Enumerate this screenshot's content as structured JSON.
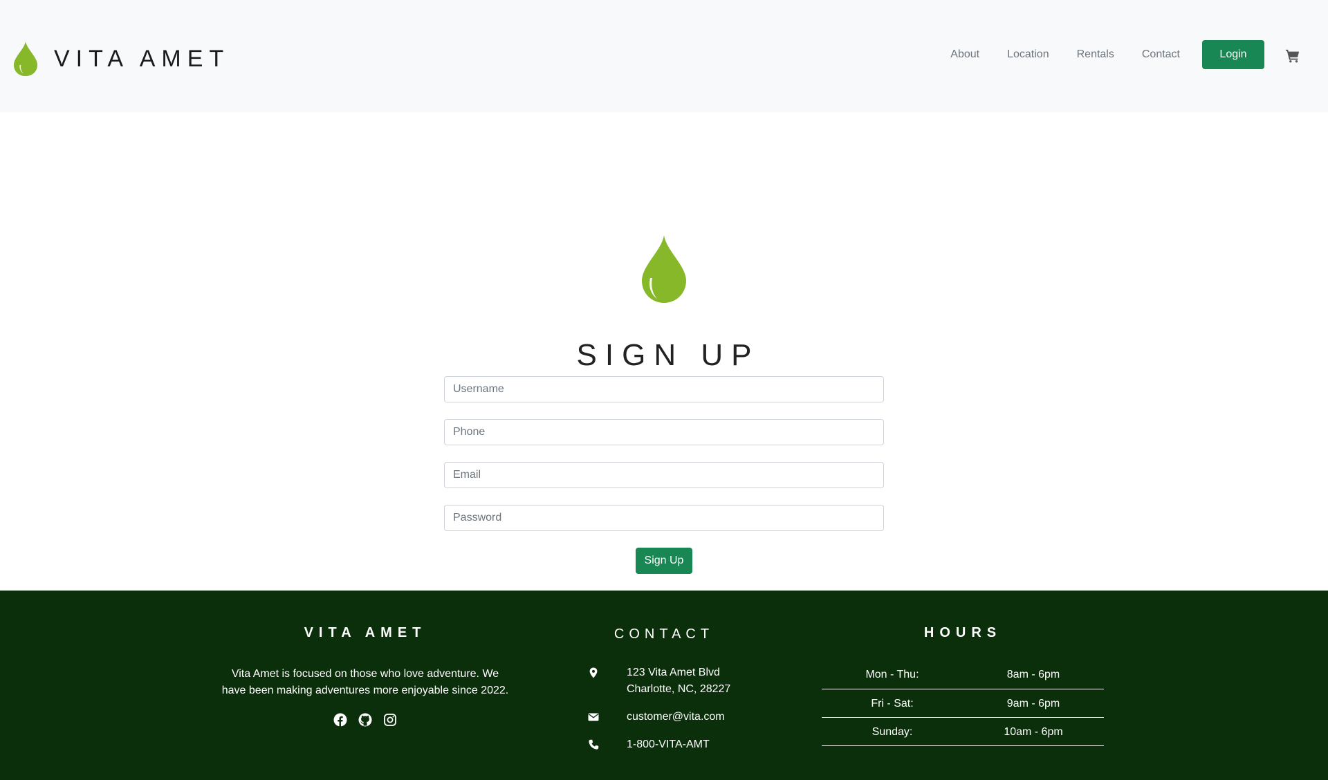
{
  "header": {
    "brand": "VITA AMET",
    "nav": [
      "About",
      "Location",
      "Rentals",
      "Contact"
    ],
    "login_label": "Login"
  },
  "signup": {
    "title": "SIGN UP",
    "username_placeholder": "Username",
    "phone_placeholder": "Phone",
    "email_placeholder": "Email",
    "password_placeholder": "Password",
    "button_label": "Sign Up"
  },
  "footer": {
    "about": {
      "heading": "VITA AMET",
      "text": "Vita Amet is focused on those who love adventure. We have been making adventures more enjoyable since 2022.",
      "socials": [
        "facebook-icon",
        "github-icon",
        "instagram-icon"
      ]
    },
    "contact": {
      "heading": "CONTACT",
      "address_line1": "123 Vita Amet Blvd",
      "address_line2": "Charlotte, NC, 28227",
      "email": "customer@vita.com",
      "phone": "1-800-VITA-AMT"
    },
    "hours": {
      "heading": "HOURS",
      "rows": [
        {
          "day": "Mon - Thu:",
          "time": "8am - 6pm"
        },
        {
          "day": "Fri - Sat:",
          "time": "9am - 6pm"
        },
        {
          "day": "Sunday:",
          "time": "10am - 6pm"
        }
      ]
    }
  },
  "colors": {
    "accent": "#198754",
    "drop": "#86b82a",
    "footer_bg": "#0b2e0b",
    "header_bg": "#f8f9fa"
  }
}
